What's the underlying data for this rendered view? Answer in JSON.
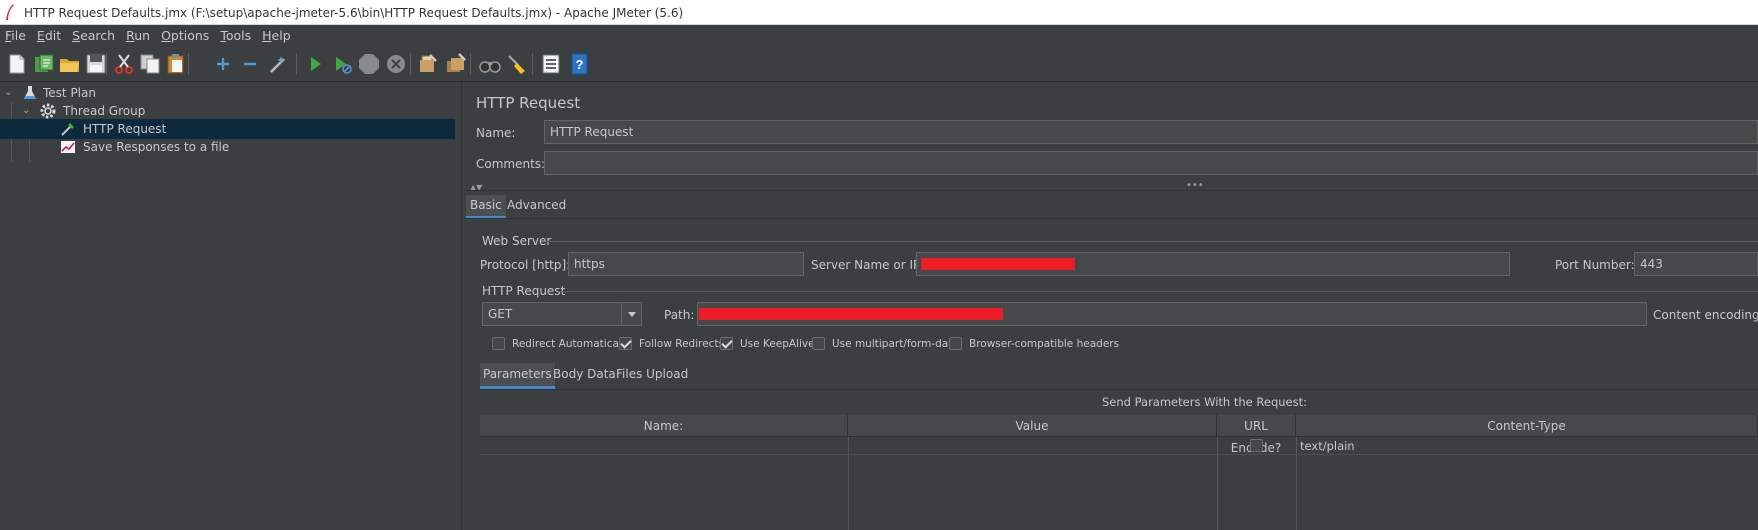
{
  "window": {
    "title": "HTTP Request Defaults.jmx (F:\\setup\\apache-jmeter-5.6\\bin\\HTTP Request Defaults.jmx) - Apache JMeter (5.6)"
  },
  "menu": [
    {
      "mnemonic": "F",
      "rest": "ile"
    },
    {
      "mnemonic": "E",
      "rest": "dit"
    },
    {
      "mnemonic": "S",
      "rest": "earch"
    },
    {
      "mnemonic": "R",
      "rest": "un"
    },
    {
      "mnemonic": "O",
      "rest": "ptions"
    },
    {
      "mnemonic": "T",
      "rest": "ools"
    },
    {
      "mnemonic": "H",
      "rest": "elp"
    }
  ],
  "toolbar_icons": [
    "new-file-icon",
    "templates-icon",
    "open-folder-icon",
    "save-icon",
    "cut-icon",
    "copy-icon",
    "paste-icon",
    "expand-plus-icon",
    "collapse-minus-icon",
    "toggle-wand-icon",
    "start-icon",
    "start-no-pause-icon",
    "stop-icon",
    "shutdown-icon",
    "clear-icon",
    "clear-all-icon",
    "search-binoculars-icon",
    "reset-search-broom-icon",
    "function-helper-icon",
    "help-icon"
  ],
  "tree": {
    "items": [
      {
        "label": "Test Plan",
        "icon": "flask-icon",
        "expanded": true
      },
      {
        "label": "Thread Group",
        "icon": "gear-icon",
        "expanded": true
      },
      {
        "label": "HTTP Request",
        "icon": "pipette-icon",
        "selected": true
      },
      {
        "label": "Save Responses to a file",
        "icon": "chart-icon"
      }
    ]
  },
  "panel": {
    "title": "HTTP Request",
    "name_label": "Name:",
    "name_value": "HTTP Request",
    "comments_label": "Comments:",
    "comments_value": "",
    "tabs": [
      {
        "label": "Basic",
        "active": true
      },
      {
        "label": "Advanced",
        "active": false
      }
    ],
    "web_server": {
      "section_label": "Web Server",
      "protocol_label": "Protocol [http]:",
      "protocol_value": "https",
      "server_label": "Server Name or IP:",
      "port_label": "Port Number:",
      "port_value": "443"
    },
    "http_request": {
      "section_label": "HTTP Request",
      "method": "GET",
      "path_label": "Path:",
      "encoding_label": "Content encoding:"
    },
    "options": [
      {
        "label": "Redirect Automatically",
        "checked": false
      },
      {
        "label": "Follow Redirects",
        "checked": true
      },
      {
        "label": "Use KeepAlive",
        "checked": true
      },
      {
        "label": "Use multipart/form-data",
        "checked": false
      },
      {
        "label": "Browser-compatible headers",
        "checked": false
      }
    ],
    "sub_tabs": [
      {
        "label": "Parameters",
        "active": true
      },
      {
        "label": "Body Data",
        "active": false
      },
      {
        "label": "Files Upload",
        "active": false
      }
    ],
    "params_caption": "Send Parameters With the Request:",
    "table": {
      "columns": [
        "Name:",
        "Value",
        "URL Encode?",
        "Content-Type"
      ],
      "rows": [
        {
          "name": "",
          "value": "",
          "url_encode": false,
          "content_type": "text/plain"
        }
      ]
    }
  },
  "colors": {
    "accent": "#4a88c7",
    "selection": "#0d293e",
    "redaction": "#ee1c25"
  }
}
